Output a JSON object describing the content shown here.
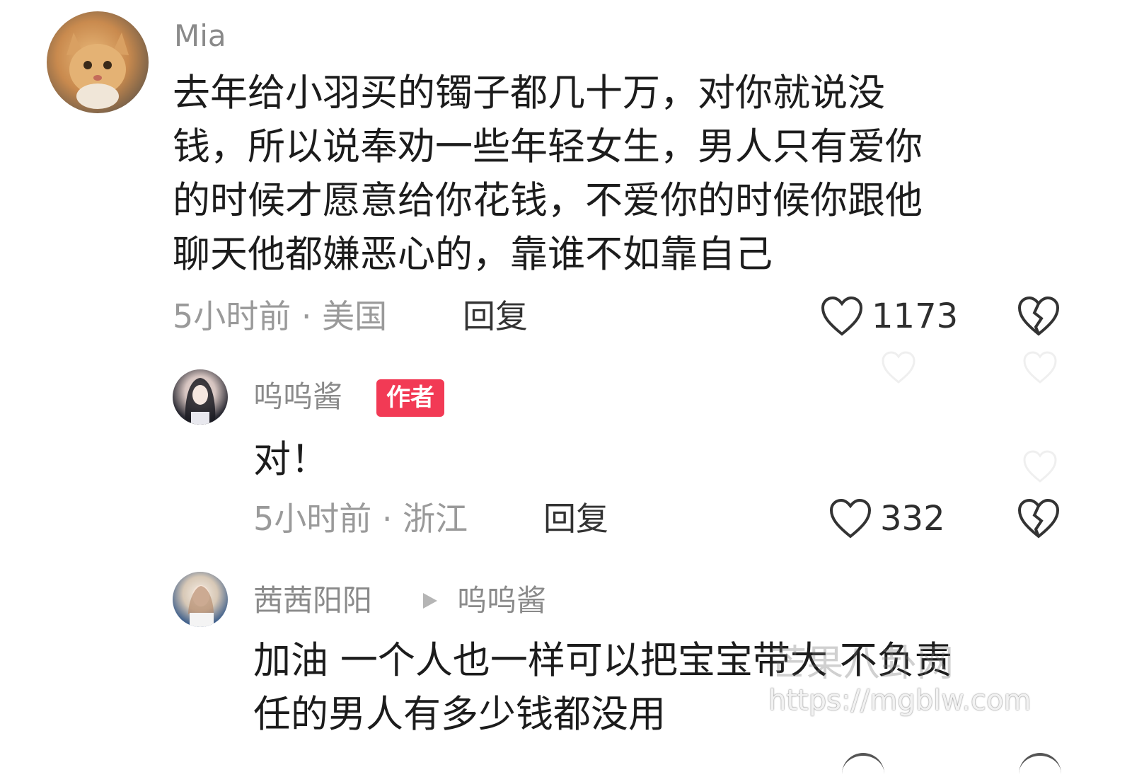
{
  "comments": [
    {
      "user": "Mia",
      "text_lines": [
        "去年给小羽买的镯子都几十万，对你就说没",
        "钱，所以说奉劝一些年轻女生，男人只有爱你",
        "的时候才愿意给你花钱，不爱你的时候你跟他",
        "聊天他都嫌恶心的，靠谁不如靠自己"
      ],
      "meta": "5小时前 · 美国",
      "reply_label": "回复",
      "likes": "1173"
    },
    {
      "user": "呜呜酱",
      "badge": "作者",
      "text": "对！",
      "meta": "5小时前 · 浙江",
      "reply_label": "回复",
      "likes": "332"
    },
    {
      "user": "茜茜阳阳",
      "reply_to": "呜呜酱",
      "text_lines": [
        "加油 一个人也一样可以把宝宝带大 不负责",
        "任的男人有多少钱都没用"
      ]
    }
  ],
  "watermark": {
    "site_name": "芒果八卦网",
    "url": "https://mgblw.com"
  },
  "icons": {
    "like": "heart-outline-icon",
    "dislike": "broken-heart-icon",
    "reply_arrow": "triangle-right-icon"
  },
  "colors": {
    "badge": "#f23a55",
    "name": "#8a8a8a",
    "meta": "#9a9a9a"
  }
}
